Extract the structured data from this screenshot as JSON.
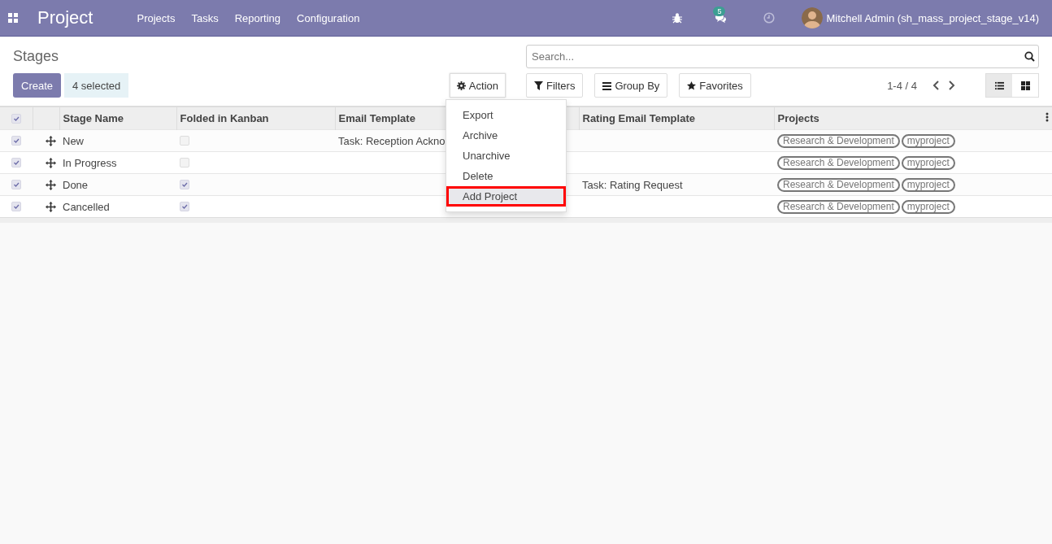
{
  "navbar": {
    "app_name": "Project",
    "menu": [
      "Projects",
      "Tasks",
      "Reporting",
      "Configuration"
    ],
    "messages_count": "5",
    "user": "Mitchell Admin (sh_mass_project_stage_v14)"
  },
  "control_panel": {
    "title": "Stages",
    "create_button": "Create",
    "selection": "4 selected",
    "action_button": "Action",
    "search": {
      "placeholder": "Search..."
    },
    "search_buttons": [
      {
        "kind": "filter",
        "label": "Filters"
      },
      {
        "kind": "group",
        "label": "Group By"
      },
      {
        "kind": "favorite",
        "label": "Favorites"
      }
    ],
    "pager": "1-4 / 4",
    "views": [
      {
        "kind": "list",
        "selected": true
      },
      {
        "kind": "kanban",
        "selected": false
      }
    ]
  },
  "action_menu": {
    "items": [
      {
        "label": "Export",
        "highlighted": false
      },
      {
        "label": "Archive",
        "highlighted": false
      },
      {
        "label": "Unarchive",
        "highlighted": false
      },
      {
        "label": "Delete",
        "highlighted": false
      },
      {
        "label": "Add Project",
        "highlighted": true
      }
    ]
  },
  "table": {
    "all_checked": true,
    "columns": [
      "Stage Name",
      "Folded in Kanban",
      "Email Template",
      "Rating Email Template",
      "Projects"
    ],
    "rows": [
      {
        "checked": true,
        "stage_name": "New",
        "folded": false,
        "email_template": "Task: Reception Ackno",
        "rating_template": "",
        "projects": [
          "Research & Development",
          "myproject"
        ]
      },
      {
        "checked": true,
        "stage_name": "In Progress",
        "folded": false,
        "email_template": "",
        "rating_template": "",
        "projects": [
          "Research & Development",
          "myproject"
        ]
      },
      {
        "checked": true,
        "stage_name": "Done",
        "folded": true,
        "email_template": "",
        "rating_template": "Task: Rating Request",
        "projects": [
          "Research & Development",
          "myproject"
        ]
      },
      {
        "checked": true,
        "stage_name": "Cancelled",
        "folded": true,
        "email_template": "",
        "rating_template": "",
        "projects": [
          "Research & Development",
          "myproject"
        ]
      }
    ]
  }
}
